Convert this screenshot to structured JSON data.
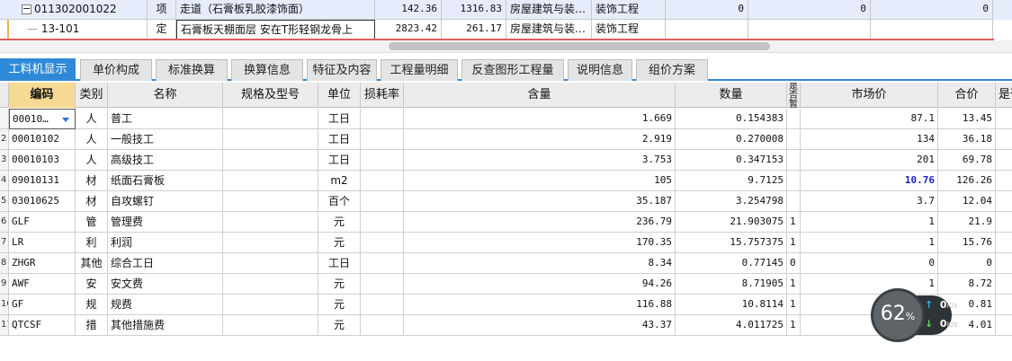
{
  "top_rows": [
    {
      "code": "011302001022",
      "type": "项",
      "name": "走道（石膏板乳胶漆饰面）",
      "qty": "142.36",
      "price": "1316.83",
      "category": "房屋建筑与装…",
      "major": "装饰工程",
      "c7": "0",
      "c8": "0",
      "c9": "0"
    },
    {
      "code": "13-101",
      "type": "定",
      "name": "石膏板天棚面层 安在T形轻钢龙骨上",
      "qty": "2823.42",
      "price": "261.17",
      "category": "房屋建筑与装…",
      "major": "装饰工程",
      "c7": "",
      "c8": "",
      "c9": ""
    }
  ],
  "tabs": [
    {
      "label": "工料机显示",
      "active": true
    },
    {
      "label": "单价构成",
      "active": false
    },
    {
      "label": "标准换算",
      "active": false
    },
    {
      "label": "换算信息",
      "active": false
    },
    {
      "label": "特征及内容",
      "active": false
    },
    {
      "label": "工程量明细",
      "active": false
    },
    {
      "label": "反查图形工程量",
      "active": false
    },
    {
      "label": "说明信息",
      "active": false
    },
    {
      "label": "组价方案",
      "active": false
    }
  ],
  "columns": {
    "code": "编码",
    "type": "类别",
    "name": "名称",
    "spec": "规格及型号",
    "unit": "单位",
    "loss": "损耗率",
    "content": "含量",
    "amount": "数量",
    "fixed": "是否暂估",
    "market": "市场价",
    "total": "合价",
    "extra": "是否"
  },
  "rows": [
    {
      "no": "",
      "code": "00010…",
      "type": "人",
      "name": "普工",
      "spec": "",
      "unit": "工日",
      "loss": "",
      "content": "1.669",
      "amount": "0.154383",
      "fixed": "",
      "market": "87.1",
      "total": "13.45"
    },
    {
      "no": "2",
      "code": "00010102",
      "type": "人",
      "name": "一般技工",
      "spec": "",
      "unit": "工日",
      "loss": "",
      "content": "2.919",
      "amount": "0.270008",
      "fixed": "",
      "market": "134",
      "total": "36.18"
    },
    {
      "no": "3",
      "code": "00010103",
      "type": "人",
      "name": "高级技工",
      "spec": "",
      "unit": "工日",
      "loss": "",
      "content": "3.753",
      "amount": "0.347153",
      "fixed": "",
      "market": "201",
      "total": "69.78"
    },
    {
      "no": "4",
      "code": "09010131",
      "type": "材",
      "name": "纸面石膏板",
      "spec": "",
      "unit": "m2",
      "loss": "",
      "content": "105",
      "amount": "9.7125",
      "fixed": "",
      "market": "10.76",
      "total": "126.26"
    },
    {
      "no": "5",
      "code": "03010625",
      "type": "材",
      "name": "自攻螺钉",
      "spec": "",
      "unit": "百个",
      "loss": "",
      "content": "35.187",
      "amount": "3.254798",
      "fixed": "",
      "market": "3.7",
      "total": "12.04"
    },
    {
      "no": "6",
      "code": "GLF",
      "type": "管",
      "name": "管理费",
      "spec": "",
      "unit": "元",
      "loss": "",
      "content": "236.79",
      "amount": "21.903075",
      "fixed": "1",
      "market": "1",
      "total": "21.9"
    },
    {
      "no": "7",
      "code": "LR",
      "type": "利",
      "name": "利润",
      "spec": "",
      "unit": "元",
      "loss": "",
      "content": "170.35",
      "amount": "15.757375",
      "fixed": "1",
      "market": "1",
      "total": "15.76"
    },
    {
      "no": "8",
      "code": "ZHGR",
      "type": "其他",
      "name": "综合工日",
      "spec": "",
      "unit": "工日",
      "loss": "",
      "content": "8.34",
      "amount": "0.77145",
      "fixed": "0",
      "market": "0",
      "total": "0"
    },
    {
      "no": "9",
      "code": "AWF",
      "type": "安",
      "name": "安文费",
      "spec": "",
      "unit": "元",
      "loss": "",
      "content": "94.26",
      "amount": "8.71905",
      "fixed": "1",
      "market": "1",
      "total": "8.72"
    },
    {
      "no": "10",
      "code": "GF",
      "type": "规",
      "name": "规费",
      "spec": "",
      "unit": "元",
      "loss": "",
      "content": "116.88",
      "amount": "10.8114",
      "fixed": "1",
      "market": "",
      "total": "0.81"
    },
    {
      "no": "11",
      "code": "QTCSF",
      "type": "措",
      "name": "其他措施费",
      "spec": "",
      "unit": "元",
      "loss": "",
      "content": "43.37",
      "amount": "4.011725",
      "fixed": "1",
      "market": "",
      "total": "4.01"
    }
  ],
  "speed_widget": {
    "percent": "62",
    "percent_sign": "%",
    "up": "0",
    "down": "0",
    "unit": "K/s",
    "up_arrow": "↑",
    "down_arrow": "↓"
  },
  "colors": {
    "accent": "#2e8ad8",
    "header_selected": "#f6d993",
    "highlight_value": "#1a22c7",
    "red_line": "#e45c5c"
  }
}
